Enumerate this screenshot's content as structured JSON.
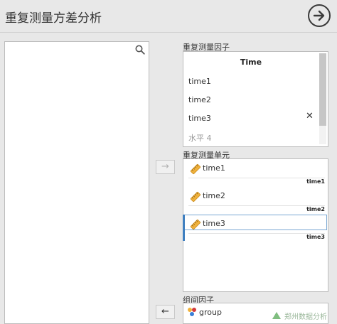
{
  "header": {
    "title": "重复测量方差分析"
  },
  "rm_factors": {
    "section_label": "重复测量因子",
    "factor_name": "Time",
    "levels": [
      "time1",
      "time2",
      "time3"
    ],
    "new_level_placeholder": "水平 4"
  },
  "rm_cells": {
    "section_label": "重复测量单元",
    "cells": [
      {
        "variable": "time1",
        "label": "time1"
      },
      {
        "variable": "time2",
        "label": "time2"
      },
      {
        "variable": "time3",
        "label": "time3"
      }
    ]
  },
  "between": {
    "section_label": "组间因子",
    "items": [
      "group"
    ]
  },
  "buttons": {
    "move_right": "→",
    "move_left": "←",
    "remove_level": "✕"
  },
  "watermark": {
    "text": "郑州数据分析"
  },
  "colors": {
    "accent": "#3f7fc0",
    "ruler": "#f0b23c"
  }
}
